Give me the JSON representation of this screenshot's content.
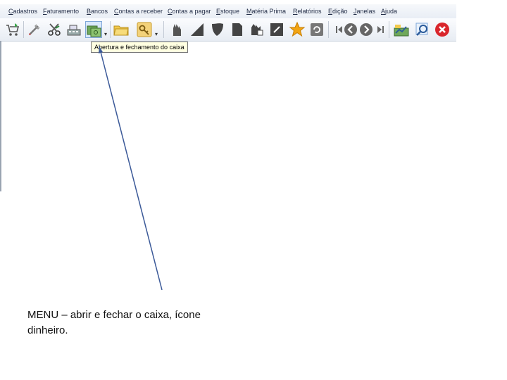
{
  "menu": {
    "items": [
      "Cadastros",
      "Faturamento",
      "Bancos",
      "Contas a receber",
      "Contas a pagar",
      "Estoque",
      "Matéria Prima",
      "Relatórios",
      "Edição",
      "Janelas",
      "Ajuda"
    ]
  },
  "toolbar": {
    "icons": [
      "cart-icon",
      "tools-icon",
      "scissors-icon",
      "cash-register-icon",
      "money-icon",
      "folder-icon",
      "key-icon",
      "hand-icon",
      "triangle-shape-icon",
      "shield-shape-icon",
      "document-shape-icon",
      "hand-write-icon",
      "edit-icon",
      "star-icon",
      "refresh-icon",
      "first-icon",
      "previous-icon",
      "next-icon",
      "last-icon",
      "chart-icon",
      "search-icon",
      "close-icon"
    ],
    "accent_close": "#d9262c"
  },
  "tooltip": {
    "text": "Abertura e fechamento do caixa"
  },
  "caption": {
    "line1": "MENU – abrir  e fechar o caixa, ícone",
    "line2": "dinheiro."
  },
  "colors": {
    "arrow": "#3b5998",
    "tooltip_bg": "#ffffe1"
  }
}
